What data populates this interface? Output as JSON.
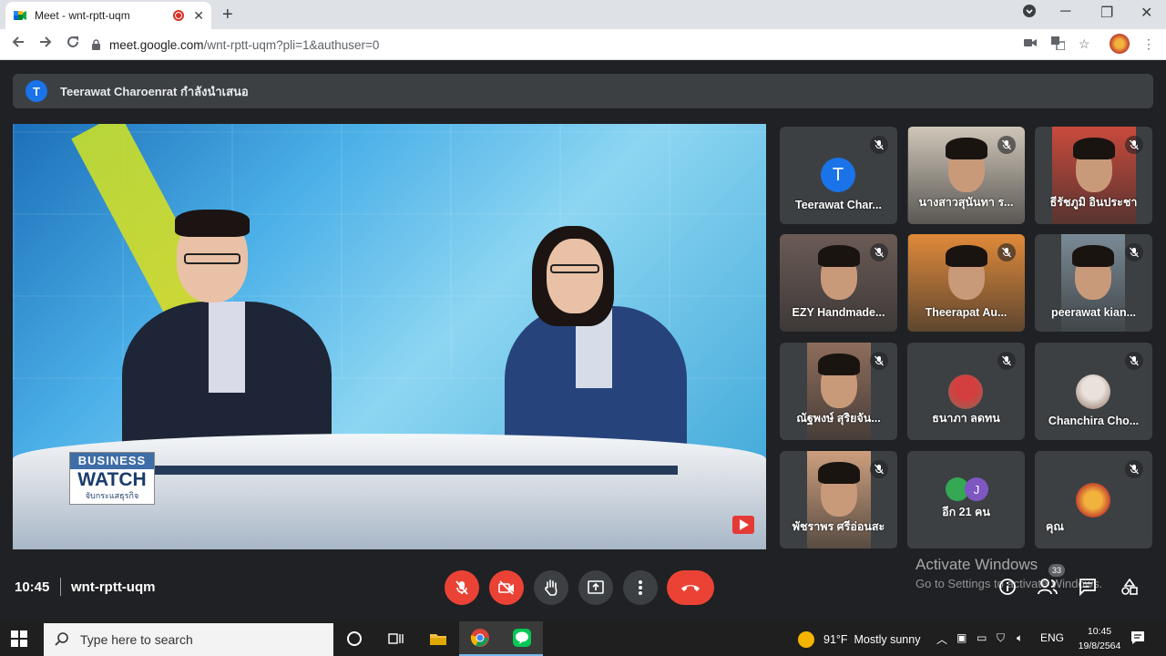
{
  "browser": {
    "tab_title": "Meet - wnt-rptt-uqm",
    "new_tab": "+",
    "url_host": "meet.google.com",
    "url_path": "/wnt-rptt-uqm?pli=1&authuser=0"
  },
  "meet": {
    "presenter_initial": "T",
    "presenting_text": "Teerawat Charoenrat กำลังนำเสนอ",
    "logo_line1": "BUSINESS",
    "logo_line2": "WATCH",
    "logo_line3": "จับกระแสธุรกิจ",
    "participants": [
      {
        "name": "Teerawat Char...",
        "initial": "T",
        "kind": "avatar"
      },
      {
        "name": "นางสาวสุนันทา ร...",
        "kind": "photo",
        "tone": "#cfc6b8"
      },
      {
        "name": "ธีรัชภูมิ อินประชา",
        "kind": "photo",
        "tone": "#c94a3c"
      },
      {
        "name": "EZY Handmade...",
        "kind": "photo",
        "tone": "#6b5b56"
      },
      {
        "name": "Theerapat Au...",
        "kind": "photo",
        "tone": "#e08a3a"
      },
      {
        "name": "peerawat kian...",
        "kind": "photo",
        "tone": "#7a8a95"
      },
      {
        "name": "ณัฐพงษ์ สุริยจัน...",
        "kind": "photo",
        "tone": "#8e6d5b"
      },
      {
        "name": "ธนาภา ลดทน",
        "kind": "small-photo",
        "tone": "#d33f3f"
      },
      {
        "name": "Chanchira Cho...",
        "kind": "small-photo",
        "tone": "#e9e1dc"
      },
      {
        "name": "พัชราพร ศรีอ่อนสะ",
        "kind": "photo",
        "tone": "#cc9f7e"
      },
      {
        "name": "อีก 21 คน",
        "kind": "others",
        "initial": "J"
      },
      {
        "name": "คุณ",
        "kind": "self"
      }
    ],
    "time": "10:45",
    "meeting_code": "wnt-rptt-uqm",
    "people_count": "33"
  },
  "watermark": {
    "line1": "Activate Windows",
    "line2": "Go to Settings to activate Windows."
  },
  "taskbar": {
    "search_placeholder": "Type here to search",
    "temperature": "91°F",
    "weather": "Mostly sunny",
    "lang": "ENG",
    "clock_time": "10:45",
    "clock_date": "19/8/2564"
  },
  "colors": {
    "meet_bg": "#202124",
    "tile_bg": "#3c4043",
    "danger": "#ea4335",
    "accent": "#1a73e8"
  }
}
